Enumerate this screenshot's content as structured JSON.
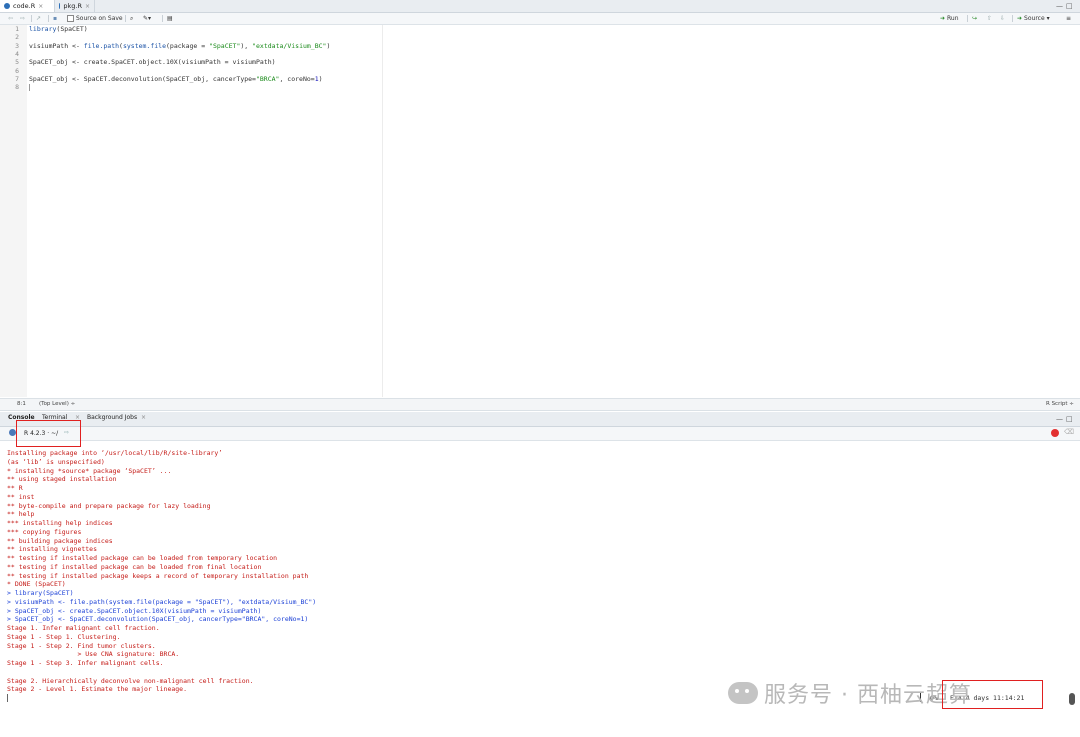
{
  "editor_tabs": [
    {
      "label": "code.R",
      "active": true
    },
    {
      "label": "pkg.R",
      "active": false
    }
  ],
  "editor_toolbar": {
    "source_on_save": "Source on Save",
    "run_label": "Run",
    "source_label": "Source"
  },
  "code": {
    "line_numbers": [
      "1",
      "2",
      "3",
      "4",
      "5",
      "6",
      "7",
      "8"
    ],
    "l1_fn": "library",
    "l1_rest": "(SpaCET)",
    "l3_a": "visiumPath <- ",
    "l3_fn": "file.path",
    "l3_b": "(",
    "l3_fn2": "system.file",
    "l3_c": "(package = ",
    "l3_s1": "\"SpaCET\"",
    "l3_d": "), ",
    "l3_s2": "\"extdata/Visium_BC\"",
    "l3_e": ")",
    "l5_a": "SpaCET_obj <- create.SpaCET.object.10X(visiumPath = visiumPath)",
    "l7_a": "SpaCET_obj <- SpaCET.deconvolution(SpaCET_obj, cancerType=",
    "l7_s": "\"BRCA\"",
    "l7_b": ", coreNo=",
    "l7_n": "1",
    "l7_c": ")"
  },
  "editor_status": {
    "position": "8:1",
    "scope": "(Top Level) ÷",
    "filetype": "R Script ÷"
  },
  "console_tabs": [
    {
      "label": "Console"
    },
    {
      "label": "Terminal"
    },
    {
      "label": "Background Jobs"
    }
  ],
  "console_toolbar": {
    "r_version": "R 4.2.3 · ~/"
  },
  "console_lines": [
    {
      "text": "Installing package into ‘/usr/local/lib/R/site-library’",
      "color": "red"
    },
    {
      "text": "(as ‘lib’ is unspecified)",
      "color": "red"
    },
    {
      "text": "* installing *source* package ‘SpaCET’ ...",
      "color": "red"
    },
    {
      "text": "** using staged installation",
      "color": "red"
    },
    {
      "text": "** R",
      "color": "red"
    },
    {
      "text": "** inst",
      "color": "red"
    },
    {
      "text": "** byte-compile and prepare package for lazy loading",
      "color": "red"
    },
    {
      "text": "** help",
      "color": "red"
    },
    {
      "text": "*** installing help indices",
      "color": "red"
    },
    {
      "text": "*** copying figures",
      "color": "red"
    },
    {
      "text": "** building package indices",
      "color": "red"
    },
    {
      "text": "** installing vignettes",
      "color": "red"
    },
    {
      "text": "** testing if installed package can be loaded from temporary location",
      "color": "red"
    },
    {
      "text": "** testing if installed package can be loaded from final location",
      "color": "red"
    },
    {
      "text": "** testing if installed package keeps a record of temporary installation path",
      "color": "red"
    },
    {
      "text": "* DONE (SpaCET)",
      "color": "red"
    },
    {
      "text": "> library(SpaCET)",
      "color": "blue"
    },
    {
      "text": "> visiumPath <- file.path(system.file(package = \"SpaCET\"), \"extdata/Visium_BC\")",
      "color": "blue"
    },
    {
      "text": "> SpaCET_obj <- create.SpaCET.object.10X(visiumPath = visiumPath)",
      "color": "blue"
    },
    {
      "text": "> SpaCET_obj <- SpaCET.deconvolution(SpaCET_obj, cancerType=\"BRCA\", coreNo=1)",
      "color": "blue"
    },
    {
      "text": "Stage 1. Infer malignant cell fraction.",
      "color": "red"
    },
    {
      "text": "Stage 1 - Step 1. Clustering.",
      "color": "red"
    },
    {
      "text": "Stage 1 - Step 2. Find tumor clusters.",
      "color": "red"
    },
    {
      "text": "                  > Use CNA signature: BRCA.",
      "color": "red"
    },
    {
      "text": "Stage 1 - Step 3. Infer malignant cells.",
      "color": "red"
    },
    {
      "text": "",
      "color": "red"
    },
    {
      "text": "Stage 2. Hierarchically deconvolve non-malignant cell fraction.",
      "color": "red"
    },
    {
      "text": "Stage 2 - Level 1. Estimate the major lineage.",
      "color": "red"
    }
  ],
  "progress": {
    "percent_text": "0%",
    "eta_text": "ETA 4 days 11:14:21"
  },
  "watermark": {
    "text": "服务号 · 西柚云超算"
  },
  "colors": {
    "console_error": "#c41a16",
    "console_input": "#1a3fd6",
    "highlight_box": "#e02020"
  }
}
